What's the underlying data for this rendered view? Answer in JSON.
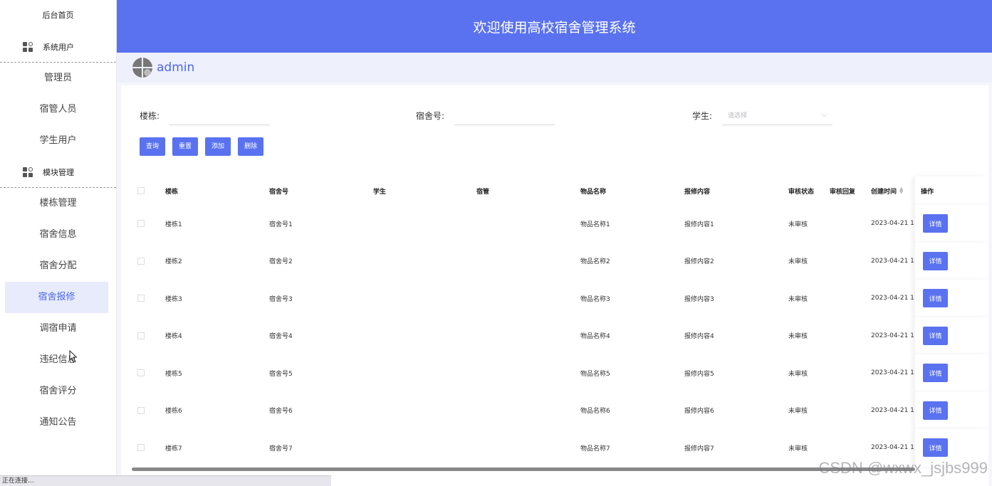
{
  "sidebar": {
    "home": "后台首页",
    "groups": [
      {
        "label": "系统用户",
        "icon": "grid-icon",
        "items": [
          "管理员",
          "宿管人员",
          "学生用户"
        ]
      },
      {
        "label": "模块管理",
        "icon": "grid-icon",
        "items": [
          "楼栋管理",
          "宿舍信息",
          "宿舍分配",
          "宿舍报修",
          "调宿申请",
          "违纪信息",
          "宿舍评分",
          "通知公告"
        ]
      }
    ],
    "active_item": "宿舍报修"
  },
  "header": {
    "title": "欢迎使用高校宿舍管理系统"
  },
  "user": {
    "name": "admin"
  },
  "search": {
    "building_label": "楼栋:",
    "room_label": "宿舍号:",
    "student_label": "学生:",
    "student_placeholder": "请选择"
  },
  "buttons": {
    "query": "查询",
    "reset": "重置",
    "add": "添加",
    "delete": "删除"
  },
  "table": {
    "columns": [
      "楼栋",
      "宿舍号",
      "学生",
      "宿管",
      "物品名称",
      "报修内容",
      "审核状态",
      "审核回复",
      "创建时间",
      "操作"
    ],
    "detail_label": "详情",
    "rows": [
      {
        "building": "楼栋1",
        "room": "宿舍号1",
        "student": "",
        "manager": "",
        "item": "物品名称1",
        "content": "报修内容1",
        "status": "未审核",
        "reply": "",
        "created": "2023-04-21 1"
      },
      {
        "building": "楼栋2",
        "room": "宿舍号2",
        "student": "",
        "manager": "",
        "item": "物品名称2",
        "content": "报修内容2",
        "status": "未审核",
        "reply": "",
        "created": "2023-04-21 1"
      },
      {
        "building": "楼栋3",
        "room": "宿舍号3",
        "student": "",
        "manager": "",
        "item": "物品名称3",
        "content": "报修内容3",
        "status": "未审核",
        "reply": "",
        "created": "2023-04-21 1"
      },
      {
        "building": "楼栋4",
        "room": "宿舍号4",
        "student": "",
        "manager": "",
        "item": "物品名称4",
        "content": "报修内容4",
        "status": "未审核",
        "reply": "",
        "created": "2023-04-21 1"
      },
      {
        "building": "楼栋5",
        "room": "宿舍号5",
        "student": "",
        "manager": "",
        "item": "物品名称5",
        "content": "报修内容5",
        "status": "未审核",
        "reply": "",
        "created": "2023-04-21 1"
      },
      {
        "building": "楼栋6",
        "room": "宿舍号6",
        "student": "",
        "manager": "",
        "item": "物品名称6",
        "content": "报修内容6",
        "status": "未审核",
        "reply": "",
        "created": "2023-04-21 1"
      },
      {
        "building": "楼栋7",
        "room": "宿舍号7",
        "student": "",
        "manager": "",
        "item": "物品名称7",
        "content": "报修内容7",
        "status": "未审核",
        "reply": "",
        "created": "2023-04-21 1"
      }
    ]
  },
  "statusbar": {
    "text": "正在连接..."
  },
  "watermark": "CSDN @wxwx_jsjbs999",
  "colors": {
    "accent": "#5a72f0",
    "active_bg": "#e8ebfb"
  }
}
